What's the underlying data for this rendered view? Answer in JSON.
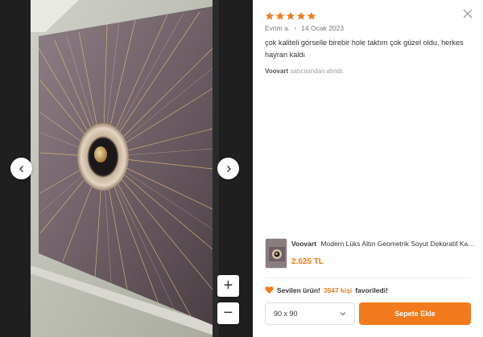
{
  "gallery": {
    "prev_icon": "chevron-left-icon",
    "next_icon": "chevron-right-icon",
    "zoom_in_label": "+",
    "zoom_out_label": "−"
  },
  "review": {
    "rating": 5,
    "author": "Evrim a.",
    "date": "14 Ocak 2023",
    "text": "çok kaliteli görselle birebir hole taktım çok güzel oldu. herkes hayran kaldı",
    "seller_name": "Voovart",
    "seller_suffix": "satıcısından alındı."
  },
  "product": {
    "brand": "Voovart",
    "title": "Modern Lüks Altın Geometrik Soyut Dekoratif Kanvas Tablo",
    "price": "2.625 TL"
  },
  "favorite": {
    "prefix": "Sevilen ürün!",
    "count": "3547 kişi",
    "suffix": "favoriledi!"
  },
  "cart": {
    "selected_size": "90 x 90",
    "add_label": "Sepete Ekle"
  },
  "colors": {
    "accent": "#f27a1a",
    "star": "#f27a1a",
    "gallery_bg": "#1f1f1f"
  }
}
